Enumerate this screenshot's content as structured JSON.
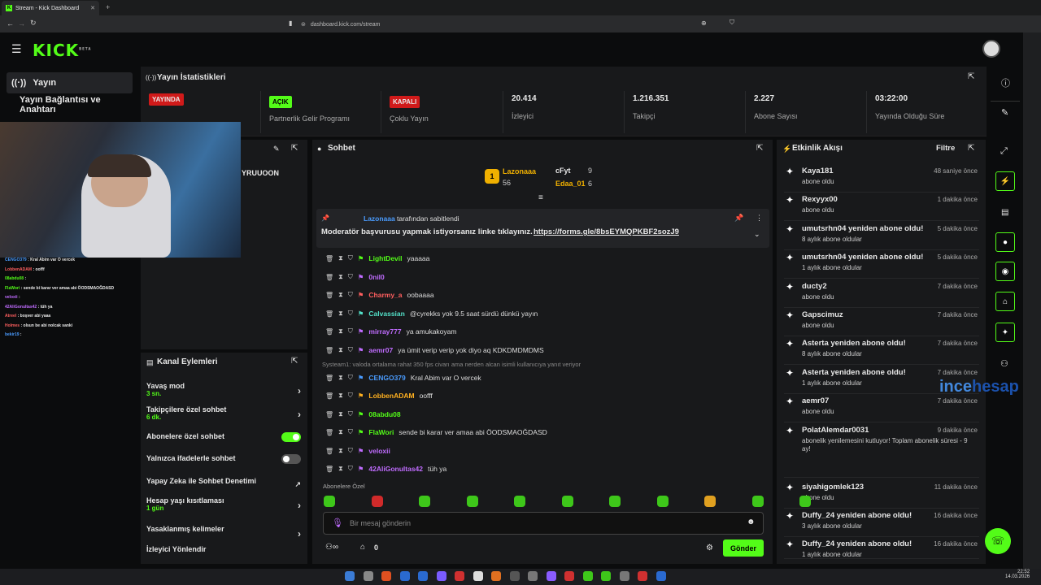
{
  "browser": {
    "tab_title": "Stream - Kick Dashboard",
    "url": "dashboard.kick.com/stream"
  },
  "brand": {
    "logo": "KICK",
    "beta": "BETA",
    "accent": "#53fc18"
  },
  "sidebar": {
    "items": [
      {
        "label": "Yayın"
      },
      {
        "label": "Yayın Bağlantısı ve Anahtarı"
      }
    ]
  },
  "stats": {
    "title": "Yayın İstatistikleri",
    "items": [
      {
        "badge": "YAYINDA",
        "label": ""
      },
      {
        "badge": "AÇIK",
        "label": "Partnerlik Gelir Programı"
      },
      {
        "badge": "KAPALI",
        "label": "Çoklu Yayın"
      },
      {
        "value": "20.414",
        "label": "İzleyici"
      },
      {
        "value": "1.216.351",
        "label": "Takipçi"
      },
      {
        "value": "2.227",
        "label": "Abone Sayısı"
      },
      {
        "value": "03:22:00",
        "label": "Yayında Olduğu Süre"
      }
    ]
  },
  "preview": {
    "partial_name": "YRUUOON",
    "cam_chat": [
      {
        "u": "CENGO379",
        "m": "Kral Abim var O vercek",
        "c": "#4a9cff"
      },
      {
        "u": "LobbenADAM",
        "m": "oofff",
        "c": "#ff5f5f"
      },
      {
        "u": "08abdu08",
        "m": "",
        "c": "#53fc18"
      },
      {
        "u": "FlaWori",
        "m": "sende bi karar ver amaa abi ÖODSMAOĞDASD",
        "c": "#53fc18"
      },
      {
        "u": "veloxii",
        "m": "",
        "c": "#c06cff"
      },
      {
        "u": "42AliGonultas42",
        "m": "tüh ya",
        "c": "#c06cff"
      },
      {
        "u": "Atreel",
        "m": "boşver abi yaaa",
        "c": "#ff5f5f"
      },
      {
        "u": "Holmes",
        "m": "olsun be abi nolcak sanki",
        "c": "#ff5f5f"
      },
      {
        "u": "bekir19",
        "m": "",
        "c": "#4a9cff"
      }
    ]
  },
  "actions": {
    "title": "Kanal Eylemleri",
    "rows": [
      {
        "label": "Yavaş mod",
        "sub": "3 sn."
      },
      {
        "label": "Takipçilere özel sohbet",
        "sub": "6 dk."
      },
      {
        "label": "Abonelere özel sohbet",
        "toggle": true
      },
      {
        "label": "Yalnızca ifadelerle sohbet",
        "toggle": false
      },
      {
        "label": "Yapay Zeka ile Sohbet Denetimi"
      },
      {
        "label": "Hesap yaşı kısıtlaması",
        "sub": "1 gün"
      },
      {
        "label": "Yasaklanmış kelimeler"
      },
      {
        "label": "İzleyici Yönlendir"
      }
    ]
  },
  "chat": {
    "title": "Sohbet",
    "leaders": [
      {
        "name": "Lazonaaa",
        "count": "56"
      },
      {
        "name": "cFyt",
        "count": "9"
      },
      {
        "name": "Edaa_01",
        "count": "6"
      }
    ],
    "pinned": {
      "by": "Lazonaaa",
      "by_suffix": "tarafından sabitlendi",
      "text": "Moderatör başvurusu yapmak istiyorsanız linke tıklayınız.",
      "link": "https://forms.gle/8bsEYMQPKBF2sozJ9"
    },
    "messages": [
      {
        "u": "LightDevil",
        "m": "yaaaaa",
        "c": "#53fc18"
      },
      {
        "u": "0nil0",
        "m": "",
        "c": "#c06cff"
      },
      {
        "u": "Charmy_a",
        "m": "oobaaaa",
        "c": "#ff5f5f"
      },
      {
        "u": "Calvassian",
        "m": "@cyrekks yok 9.5 saat sürdü dünkü yayın",
        "c": "#53e0c8"
      },
      {
        "u": "mirray777",
        "m": "ya amukakoyam",
        "c": "#c06cff"
      },
      {
        "u": "aemr07",
        "m": "ya ümit verip verip yok diyo aq KDKDMDMDMS",
        "c": "#c06cff"
      },
      {
        "u": "CENGO379",
        "m": "Kral Abim var O vercek",
        "c": "#4a9cff"
      },
      {
        "u": "LobbenADAM",
        "m": "oofff",
        "c": "#ffb020"
      },
      {
        "u": "08abdu08",
        "m": "",
        "c": "#53fc18"
      },
      {
        "u": "FlaWori",
        "m": "sende bi karar ver amaa abi ÖODSMAOĞDASD",
        "c": "#53fc18"
      },
      {
        "u": "veloxii",
        "m": "",
        "c": "#c06cff"
      },
      {
        "u": "42AliGonultas42",
        "m": "tüh ya",
        "c": "#c06cff"
      }
    ],
    "reply_context": "Systeam1: valoda ortalama rahat 350 fps civarı ama nerden alcan isimli kullanıcıya yanıt veriyor",
    "subs_only_label": "Abonelere Özel",
    "placeholder": "Bir mesaj gönderin",
    "count": "0",
    "send": "Gönder"
  },
  "feed": {
    "title": "Etkinlik Akışı",
    "filter": "Filtre",
    "items": [
      {
        "n": "Kaya181",
        "d": "abone oldu",
        "t": "48 saniye önce"
      },
      {
        "n": "Rexyyx00",
        "d": "abone oldu",
        "t": "1 dakika önce"
      },
      {
        "n": "umutsrhn04 yeniden abone oldu!",
        "d": "8 aylık abone oldular",
        "dn": "8",
        "t": "5 dakika önce"
      },
      {
        "n": "umutsrhn04 yeniden abone oldu!",
        "d": "1 aylık abone oldular",
        "dn": "1",
        "t": "5 dakika önce"
      },
      {
        "n": "ducty2",
        "d": "abone oldu",
        "t": "7 dakika önce"
      },
      {
        "n": "Gapscimuz",
        "d": "abone oldu",
        "t": "7 dakika önce"
      },
      {
        "n": "Asterta yeniden abone oldu!",
        "d": "8 aylık abone oldular",
        "dn": "8",
        "t": "7 dakika önce"
      },
      {
        "n": "Asterta yeniden abone oldu!",
        "d": "1 aylık abone oldular",
        "dn": "1",
        "t": "7 dakika önce"
      },
      {
        "n": "aemr07",
        "d": "abone oldu",
        "t": "7 dakika önce"
      },
      {
        "n": "PolatAlemdar0031",
        "d": "abonelik yenilemesini kutluyor! Toplam abonelik süresi - 9 ay!",
        "t": "9 dakika önce"
      },
      {
        "n": "siyahigomlek123",
        "d": "abone oldu",
        "t": "11 dakika önce"
      },
      {
        "n": "Duffy_24 yeniden abone oldu!",
        "d": "3 aylık abone oldular",
        "dn": "3",
        "t": "16 dakika önce"
      },
      {
        "n": "Duffy_24 yeniden abone oldu!",
        "d": "1 aylık abone oldular",
        "dn": "1",
        "t": "16 dakika önce"
      }
    ]
  },
  "watermark": {
    "a": "ince",
    "b": "hesap",
    ".com": ".com"
  },
  "clock": {
    "time": "22:52",
    "date": "14.03.2026"
  }
}
